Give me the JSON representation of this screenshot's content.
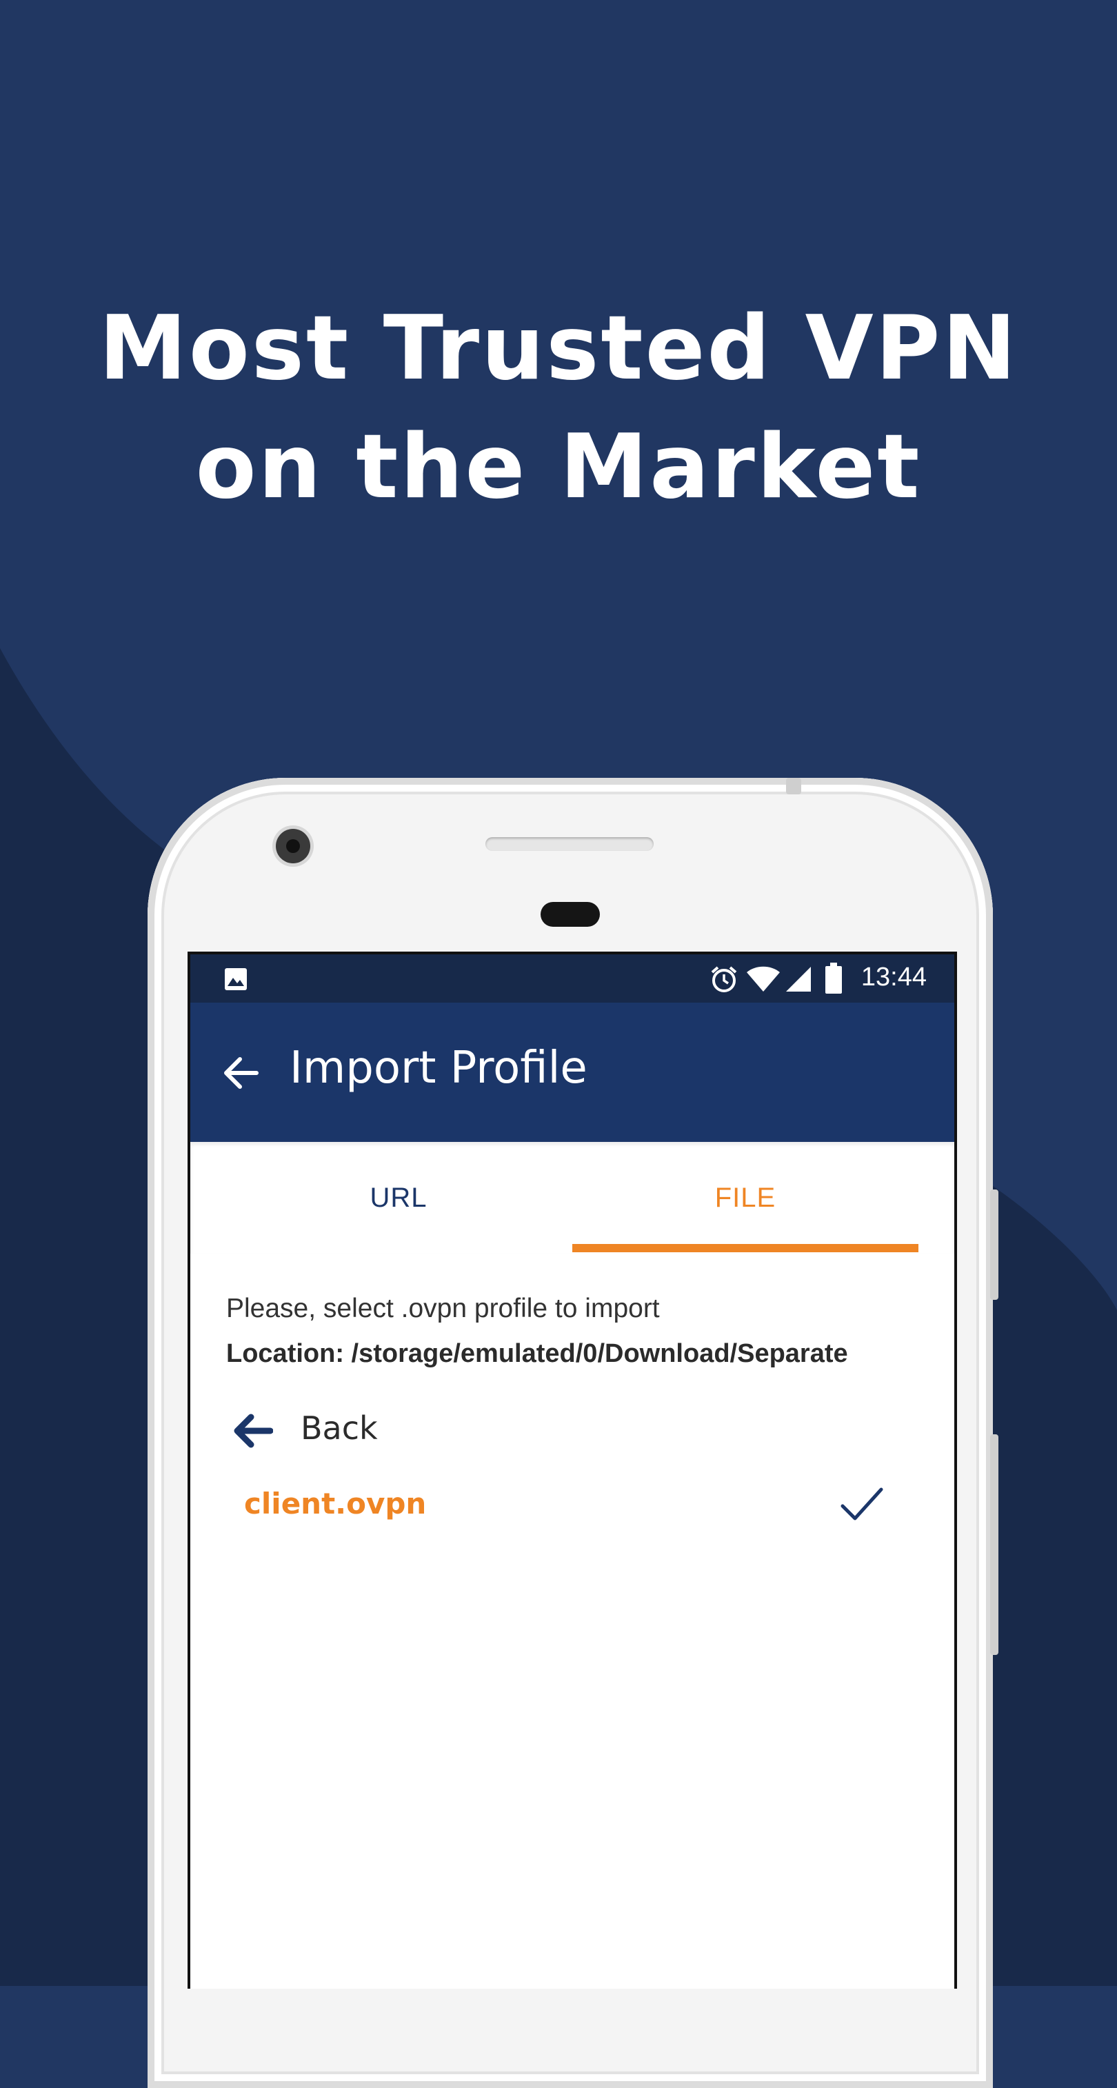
{
  "headline": {
    "line1": "Most Trusted VPN",
    "line2": "on the Market"
  },
  "colors": {
    "background": "#213762",
    "background_dark": "#18294a",
    "appbar": "#1b3669",
    "statusbar": "#17294a",
    "accent": "#ef8524"
  },
  "status_bar": {
    "time": "13:44",
    "icons": [
      "image-icon",
      "alarm-icon",
      "wifi-icon",
      "signal-icon",
      "battery-icon"
    ]
  },
  "appbar": {
    "title": "Import Profile",
    "back_icon": "arrow-left-icon"
  },
  "tabs": [
    {
      "label": "URL",
      "selected": false
    },
    {
      "label": "FILE",
      "selected": true
    }
  ],
  "content": {
    "prompt": "Please, select .ovpn profile to import",
    "location": "Location: /storage/emulated/0/Download/Separate",
    "back_label": "Back",
    "files": [
      {
        "name": "client.ovpn",
        "selected": true
      }
    ]
  }
}
